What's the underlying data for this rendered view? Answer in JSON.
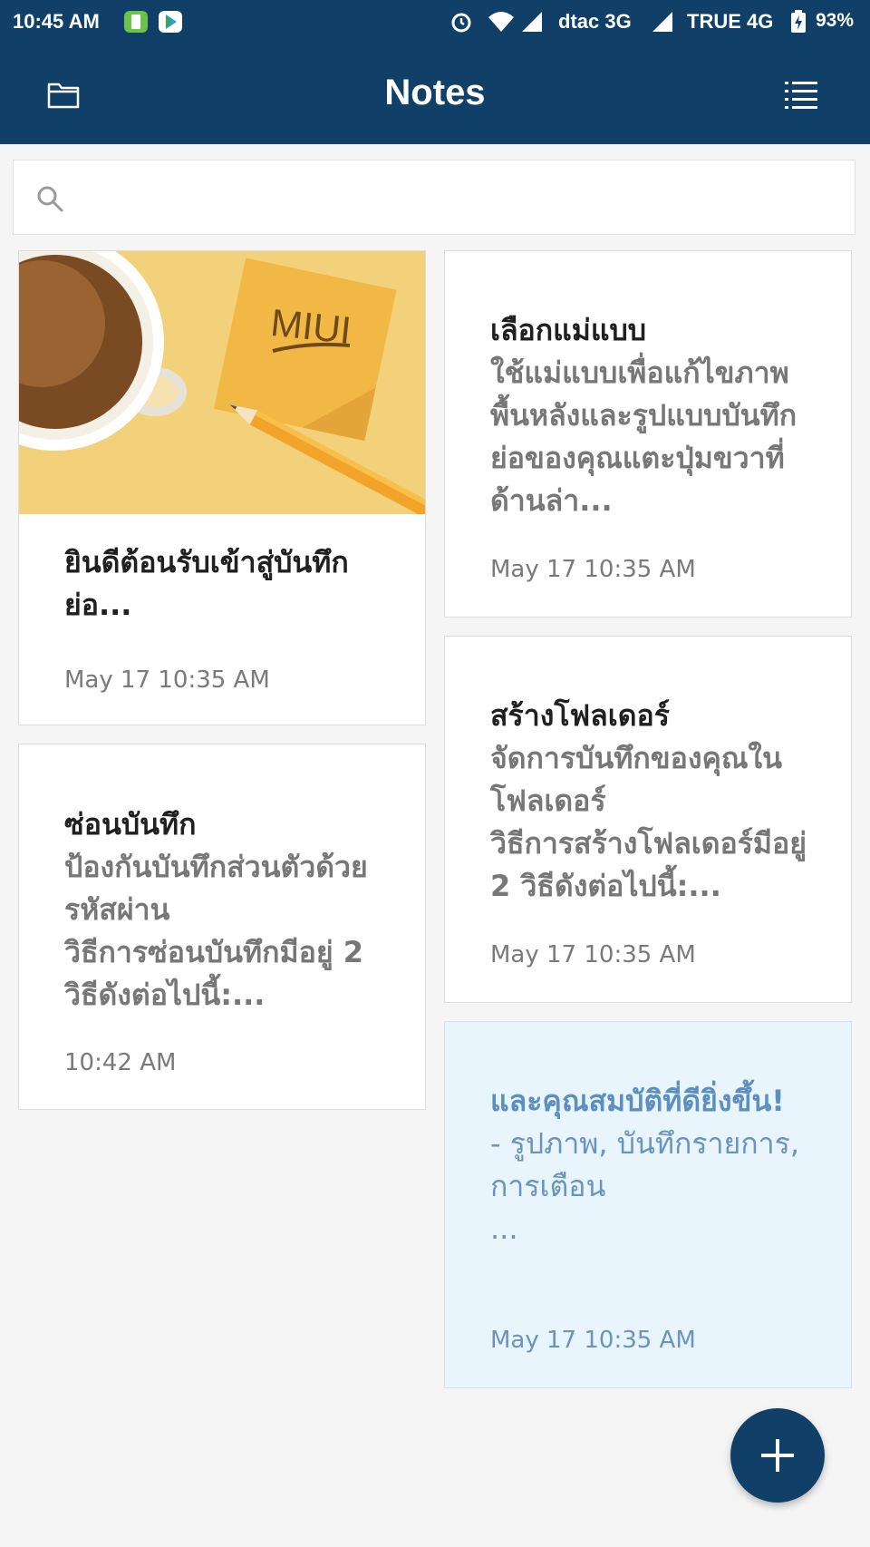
{
  "status_bar": {
    "time": "10:45 AM",
    "carrier1": "dtac 3G",
    "carrier2": "TRUE 4G",
    "battery": "93%"
  },
  "header": {
    "title": "Notes"
  },
  "search": {
    "placeholder": ""
  },
  "notes": [
    {
      "title": "ยินดีต้อนรับเข้าสู่บันทึกย่อ...",
      "body": "",
      "date": "May 17 10:35 AM",
      "image_text": "MIUI"
    },
    {
      "title": "ซ่อนบันทึก",
      "body": "ป้องกันบันทึกส่วนตัวด้วยรหัสผ่าน\nวิธีการซ่อนบันทึกมีอยู่ 2 วิธีดังต่อไปนี้:...",
      "date": "10:42 AM"
    },
    {
      "title": "เลือกแม่แบบ",
      "body": "ใช้แม่แบบเพื่อแก้ไขภาพพื้นหลังและรูปแบบบันทึกย่อของคุณแตะปุ่มขวาที่ด้านล่า...",
      "date": "May 17 10:35 AM"
    },
    {
      "title": "สร้างโฟลเดอร์",
      "body": "จัดการบันทึกของคุณในโฟลเดอร์\nวิธีการสร้างโฟลเดอร์มีอยู่ 2 วิธีดังต่อไปนี้:...",
      "date": "May 17 10:35 AM"
    },
    {
      "title": "และคุณสมบัติที่ดียิ่งขึ้น!",
      "body": " - รูปภาพ, บันทึกรายการ, การเตือน\n...",
      "date": "May 17 10:35 AM"
    }
  ],
  "colors": {
    "header_bg": "#103f68",
    "highlight_card": "#e8f5fc"
  }
}
